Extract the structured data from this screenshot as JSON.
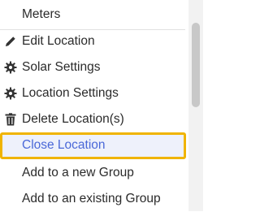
{
  "menu": {
    "items": [
      {
        "label": "Meters",
        "icon": ""
      },
      {
        "label": "Edit Location",
        "icon": "pencil-icon"
      },
      {
        "label": "Solar Settings",
        "icon": "gear-icon"
      },
      {
        "label": "Location Settings",
        "icon": "gear-icon"
      },
      {
        "label": "Delete Location(s)",
        "icon": "trash-icon"
      },
      {
        "label": "Close Location",
        "icon": ""
      },
      {
        "label": "Add to a new Group",
        "icon": ""
      },
      {
        "label": "Add to an existing Group",
        "icon": ""
      }
    ],
    "active_label_color": "#4a68d8",
    "highlight_color": "#f0b400"
  }
}
